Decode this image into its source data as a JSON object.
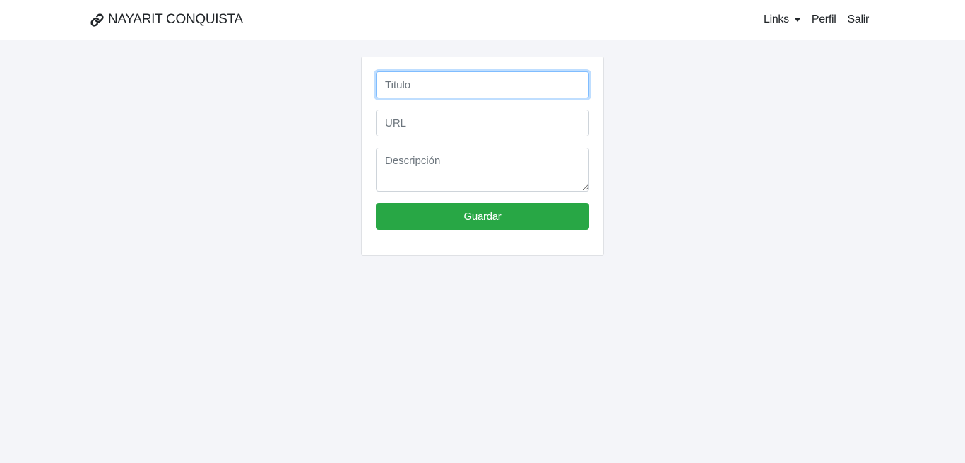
{
  "navbar": {
    "brand_icon": "link-icon",
    "brand_text": "NAYARIT CONQUISTA",
    "links_label": "Links",
    "profile_label": "Perfil",
    "logout_label": "Salir"
  },
  "form": {
    "title_placeholder": "Titulo",
    "title_value": "",
    "url_placeholder": "URL",
    "url_value": "",
    "description_placeholder": "Descripción",
    "description_value": "",
    "save_label": "Guardar"
  },
  "colors": {
    "background": "#f4f5f9",
    "navbar": "#ffffff",
    "save_button": "#28a745",
    "focus_ring": "#80bdff"
  }
}
